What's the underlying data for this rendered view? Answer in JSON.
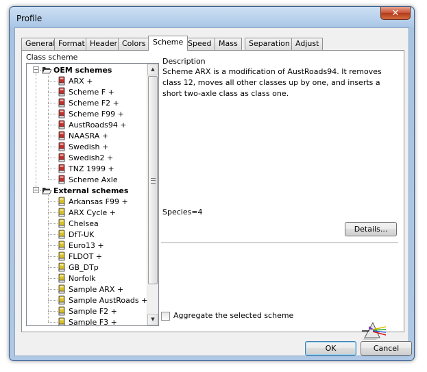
{
  "window": {
    "title": "Profile",
    "close_glyph": "✕"
  },
  "tabs": [
    "General",
    "Format",
    "Header",
    "Colors",
    "Scheme",
    "Speed",
    "Mass",
    "Separation",
    "Adjust"
  ],
  "active_tab": "Scheme",
  "class_scheme": {
    "label": "Class scheme",
    "groups": [
      {
        "name": "OEM schemes",
        "icon": "red-book-icon",
        "items": [
          "ARX +",
          "Scheme F +",
          "Scheme F2 +",
          "Scheme F99 +",
          "AustRoads94 +",
          "NAASRA +",
          "Swedish +",
          "Swedish2 +",
          "TNZ 1999 +",
          "Scheme Axle"
        ]
      },
      {
        "name": "External schemes",
        "icon": "yellow-book-icon",
        "items": [
          "Arkansas F99 +",
          "ARX Cycle +",
          "Chelsea",
          "DfT-UK",
          "Euro13 +",
          "FLDOT +",
          "GB_DTp",
          "Norfolk",
          "Sample ARX +",
          "Sample AustRoads +",
          "Sample F2 +",
          "Sample F3 +"
        ]
      }
    ]
  },
  "description": {
    "label": "Description",
    "text": "Scheme ARX is a modification of AustRoads94. It removes class 12, moves all other classes up by one, and inserts a short two-axle class as class one."
  },
  "species": "Species=4",
  "details_button": "Details...",
  "aggregate_label": "Aggregate the selected scheme",
  "aggregate_checked": false,
  "ok_button": "OK",
  "cancel_button": "Cancel",
  "colors": {
    "accent": "#3c7fb1",
    "oem_icon": "#c0312b",
    "external_icon": "#d8c22a"
  }
}
